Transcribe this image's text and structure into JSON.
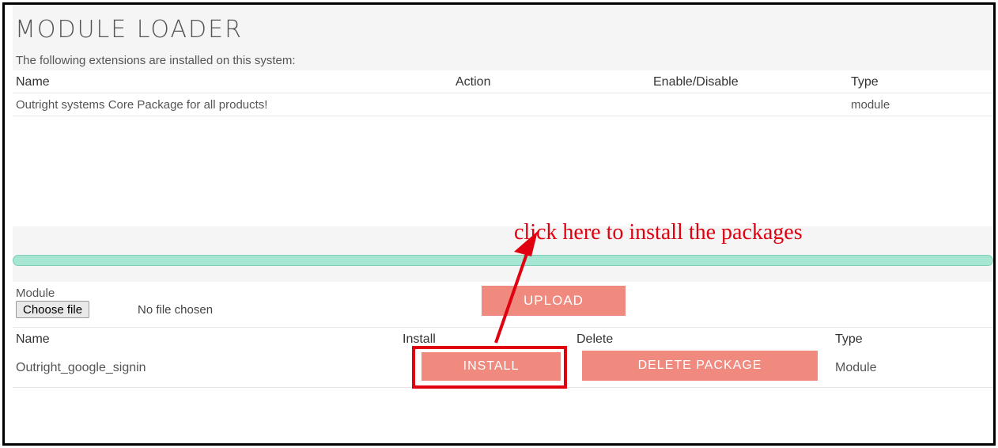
{
  "header": {
    "title": "MODULE LOADER",
    "subtitle": "The following extensions are installed on this system:"
  },
  "installed_table": {
    "columns": [
      "Name",
      "Action",
      "Enable/Disable",
      "Type"
    ],
    "rows": [
      {
        "name": "Outright systems Core Package for all products!",
        "action": "",
        "enable_disable": "",
        "type": "module"
      }
    ]
  },
  "upload": {
    "module_label": "Module",
    "choose_file_label": "Choose file",
    "no_file_text": "No file chosen",
    "upload_label": "UPLOAD"
  },
  "packages_table": {
    "columns": [
      "Name",
      "Install",
      "Delete",
      "Type"
    ],
    "rows": [
      {
        "name": "Outright_google_signin",
        "install_label": "INSTALL",
        "delete_label": "DELETE PACKAGE",
        "type": "Module"
      }
    ]
  },
  "annotation": {
    "text": "click here to install the packages",
    "color": "#e00010"
  },
  "colors": {
    "button": "#f08a7f",
    "divider": "#a8e6d4"
  }
}
